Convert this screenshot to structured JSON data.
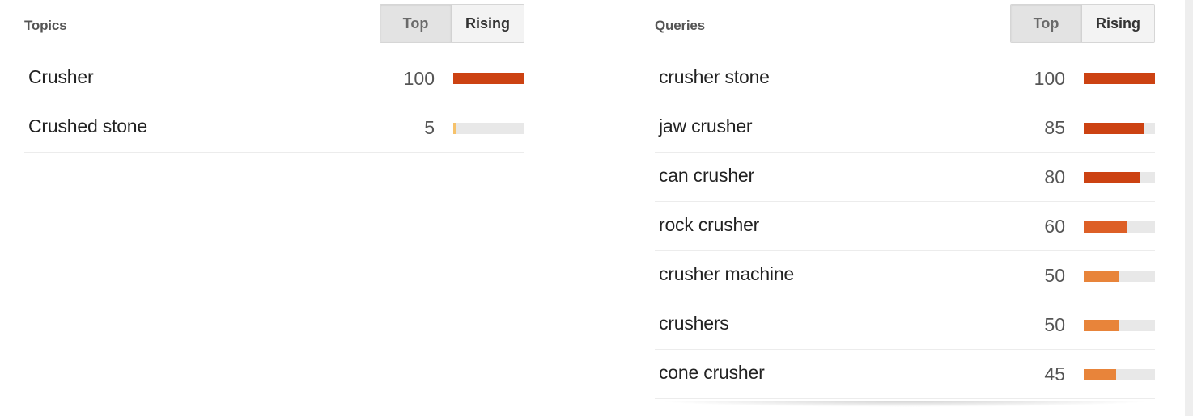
{
  "topics": {
    "title": "Topics",
    "toggle": {
      "top_label": "Top",
      "rising_label": "Rising",
      "selected": "Top"
    },
    "rows": [
      {
        "label": "Crusher",
        "value": "100",
        "percent": 100,
        "color": "#cc4212"
      },
      {
        "label": "Crushed stone",
        "value": "5",
        "percent": 5,
        "color": "#f6c26b"
      }
    ]
  },
  "queries": {
    "title": "Queries",
    "toggle": {
      "top_label": "Top",
      "rising_label": "Rising",
      "selected": "Top"
    },
    "rows": [
      {
        "label": "crusher stone",
        "value": "100",
        "percent": 100,
        "color": "#cc4212"
      },
      {
        "label": "jaw crusher",
        "value": "85",
        "percent": 85,
        "color": "#cc4212"
      },
      {
        "label": "can crusher",
        "value": "80",
        "percent": 80,
        "color": "#cc4212"
      },
      {
        "label": "rock crusher",
        "value": "60",
        "percent": 60,
        "color": "#dd5f26"
      },
      {
        "label": "crusher machine",
        "value": "50",
        "percent": 50,
        "color": "#e8843a"
      },
      {
        "label": "crushers",
        "value": "50",
        "percent": 50,
        "color": "#e8843a"
      },
      {
        "label": "cone crusher",
        "value": "45",
        "percent": 45,
        "color": "#e8843a"
      }
    ]
  },
  "colors": {
    "bar_track": "#e8e8e8",
    "scrollbar_track": "#eeeeee"
  }
}
